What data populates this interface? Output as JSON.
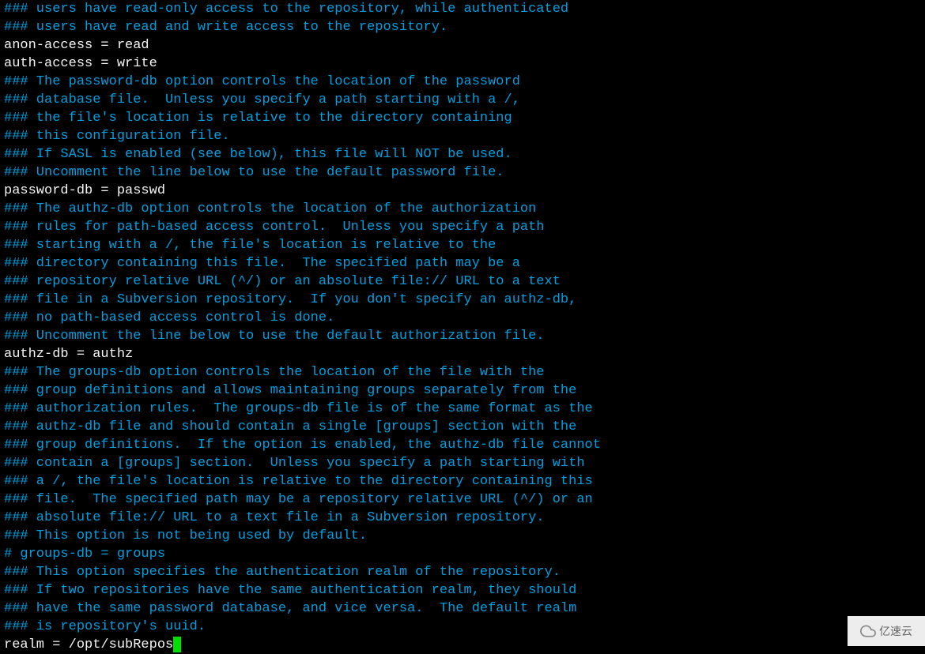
{
  "lines": [
    {
      "type": "comment",
      "text": "### users have read-only access to the repository, while authenticated"
    },
    {
      "type": "comment",
      "text": "### users have read and write access to the repository."
    },
    {
      "type": "value",
      "text": "anon-access = read"
    },
    {
      "type": "value",
      "text": "auth-access = write"
    },
    {
      "type": "comment",
      "text": "### The password-db option controls the location of the password"
    },
    {
      "type": "comment",
      "text": "### database file.  Unless you specify a path starting with a /,"
    },
    {
      "type": "comment",
      "text": "### the file's location is relative to the directory containing"
    },
    {
      "type": "comment",
      "text": "### this configuration file."
    },
    {
      "type": "comment",
      "text": "### If SASL is enabled (see below), this file will NOT be used."
    },
    {
      "type": "comment",
      "text": "### Uncomment the line below to use the default password file."
    },
    {
      "type": "value",
      "text": "password-db = passwd"
    },
    {
      "type": "comment",
      "text": "### The authz-db option controls the location of the authorization"
    },
    {
      "type": "comment",
      "text": "### rules for path-based access control.  Unless you specify a path"
    },
    {
      "type": "comment",
      "text": "### starting with a /, the file's location is relative to the"
    },
    {
      "type": "comment",
      "text": "### directory containing this file.  The specified path may be a"
    },
    {
      "type": "comment",
      "text": "### repository relative URL (^/) or an absolute file:// URL to a text"
    },
    {
      "type": "comment",
      "text": "### file in a Subversion repository.  If you don't specify an authz-db,"
    },
    {
      "type": "comment",
      "text": "### no path-based access control is done."
    },
    {
      "type": "comment",
      "text": "### Uncomment the line below to use the default authorization file."
    },
    {
      "type": "value",
      "text": "authz-db = authz"
    },
    {
      "type": "comment",
      "text": "### The groups-db option controls the location of the file with the"
    },
    {
      "type": "comment",
      "text": "### group definitions and allows maintaining groups separately from the"
    },
    {
      "type": "comment",
      "text": "### authorization rules.  The groups-db file is of the same format as the"
    },
    {
      "type": "comment",
      "text": "### authz-db file and should contain a single [groups] section with the"
    },
    {
      "type": "comment",
      "text": "### group definitions.  If the option is enabled, the authz-db file cannot"
    },
    {
      "type": "comment",
      "text": "### contain a [groups] section.  Unless you specify a path starting with"
    },
    {
      "type": "comment",
      "text": "### a /, the file's location is relative to the directory containing this"
    },
    {
      "type": "comment",
      "text": "### file.  The specified path may be a repository relative URL (^/) or an"
    },
    {
      "type": "comment",
      "text": "### absolute file:// URL to a text file in a Subversion repository."
    },
    {
      "type": "comment",
      "text": "### This option is not being used by default."
    },
    {
      "type": "comment",
      "text": "# groups-db = groups"
    },
    {
      "type": "comment",
      "text": "### This option specifies the authentication realm of the repository."
    },
    {
      "type": "comment",
      "text": "### If two repositories have the same authentication realm, they should"
    },
    {
      "type": "comment",
      "text": "### have the same password database, and vice versa.  The default realm"
    },
    {
      "type": "comment",
      "text": "### is repository's uuid."
    },
    {
      "type": "value",
      "text": "realm = /opt/subRepos",
      "cursor": true
    }
  ],
  "watermark": {
    "text": "亿速云"
  }
}
